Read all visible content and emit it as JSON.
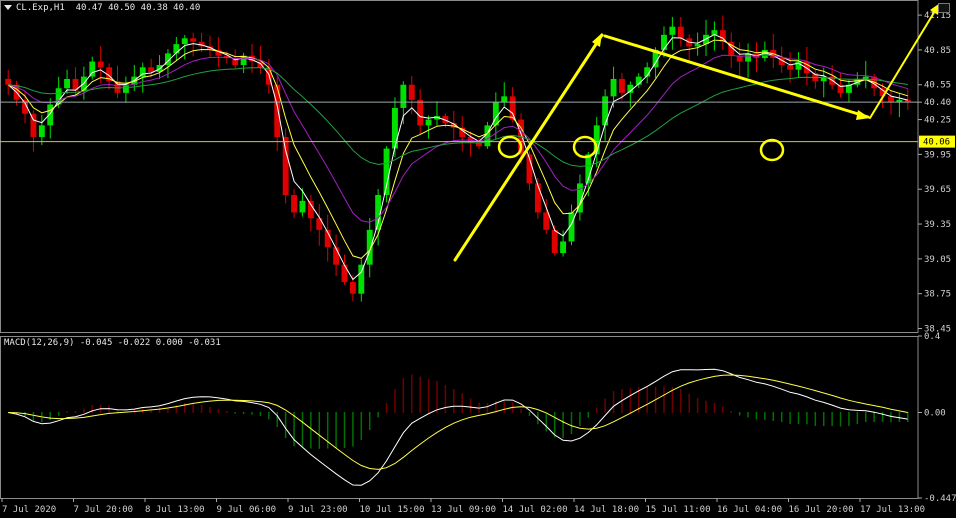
{
  "main_title": {
    "symbol_label": "CL.Exp,H1",
    "ohlc": "40.47 40.50 40.38 40.40"
  },
  "macd_title": "MACD(12,26,9) -0.045 -0.022 0.000 -0.031",
  "colors": {
    "background": "#000000",
    "bull": "#00e000",
    "bear": "#e00000",
    "ma_fast": "#ffffff",
    "ma_mid": "#ffff44",
    "ma_slow": "#a020c0",
    "ma_long": "#22a040",
    "annotation": "#ffff00",
    "hline": "#c8c850",
    "level_tag_bg": "#ffff00",
    "macd_signal": "#ffff44",
    "macd_line": "#ffffff"
  },
  "chart_data": [
    {
      "type": "candlestick",
      "timeframe": "H1",
      "ylim": [
        38.42,
        41.28
      ],
      "y_ticks": [
        "41.15",
        "40.85",
        "40.55",
        "40.40",
        "40.25",
        "39.95",
        "39.65",
        "39.35",
        "39.05",
        "38.75",
        "38.45"
      ],
      "level_tag": "40.06",
      "current_price_line": 40.4,
      "x_ticks": [
        "7 Jul 2020",
        "7 Jul 20:00",
        "8 Jul 13:00",
        "9 Jul 06:00",
        "9 Jul 23:00",
        "10 Jul 15:00",
        "13 Jul 09:00",
        "14 Jul 02:00",
        "14 Jul 18:00",
        "15 Jul 11:00",
        "16 Jul 04:00",
        "16 Jul 20:00",
        "17 Jul 13:00"
      ],
      "closes": [
        40.55,
        40.42,
        40.3,
        40.1,
        40.2,
        40.38,
        40.52,
        40.6,
        40.5,
        40.62,
        40.75,
        40.7,
        40.58,
        40.48,
        40.55,
        40.62,
        40.7,
        40.66,
        40.72,
        40.82,
        40.9,
        40.95,
        40.92,
        40.88,
        40.85,
        40.8,
        40.78,
        40.72,
        40.8,
        40.75,
        40.7,
        40.55,
        40.1,
        39.6,
        39.45,
        39.55,
        39.4,
        39.3,
        39.15,
        39.0,
        38.85,
        38.75,
        39.0,
        39.3,
        39.6,
        40.0,
        40.35,
        40.55,
        40.42,
        40.2,
        40.25,
        40.28,
        40.22,
        40.18,
        40.1,
        40.05,
        40.02,
        40.2,
        40.4,
        40.45,
        40.25,
        39.95,
        39.7,
        39.45,
        39.3,
        39.1,
        39.2,
        39.45,
        39.7,
        39.95,
        40.2,
        40.45,
        40.6,
        40.48,
        40.55,
        40.62,
        40.7,
        40.85,
        40.98,
        41.05,
        40.95,
        40.88,
        40.9,
        40.98,
        41.02,
        40.92,
        40.8,
        40.75,
        40.82,
        40.78,
        40.85,
        40.78,
        40.72,
        40.68,
        40.75,
        40.65,
        40.58,
        40.62,
        40.55,
        40.48,
        40.55,
        40.6,
        40.62,
        40.52,
        40.45,
        40.4,
        40.42,
        40.4
      ]
    },
    {
      "type": "macd",
      "params": "12,26,9",
      "ylim": [
        -0.447,
        0.4
      ],
      "y_ticks": [
        "0.4",
        "0.00",
        "-0.447"
      ]
    }
  ]
}
